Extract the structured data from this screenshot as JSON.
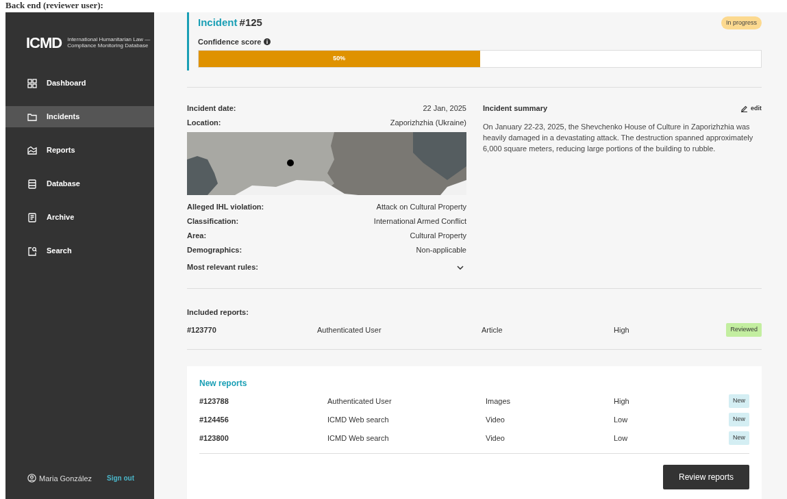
{
  "caption": "Back end (reviewer user):",
  "sidebar": {
    "logo": "ICMD",
    "logo_subtitle": "International Humanitarian Law —\nCompliance Monitoring Database",
    "items": [
      {
        "label": "Dashboard",
        "selected": false
      },
      {
        "label": "Incidents",
        "selected": true
      },
      {
        "label": "Reports",
        "selected": false
      },
      {
        "label": "Database",
        "selected": false
      },
      {
        "label": "Archive",
        "selected": false
      },
      {
        "label": "Search",
        "selected": false
      }
    ],
    "user": "Maria González",
    "sign_out": "Sign out"
  },
  "incident": {
    "label": "Incident",
    "number": "#125",
    "status": "In progress",
    "confidence_label": "Confidence score",
    "confidence": {
      "level": 0.5,
      "reading": "50%"
    }
  },
  "details_top": [
    {
      "label": "Incident date:",
      "value": "22 Jan, 2025"
    },
    {
      "label": "Location:",
      "value": "Zaporizhzhia (Ukraine)"
    }
  ],
  "details_bottom": [
    {
      "label": "Alleged IHL violation:",
      "value": "Attack on Cultural Property"
    },
    {
      "label": "Classification:",
      "value": "International Armed Conflict"
    },
    {
      "label": "Area:",
      "value": "Cultural Property"
    },
    {
      "label": "Demographics:",
      "value": "Non-applicable"
    }
  ],
  "rules": {
    "label": "Most relevant rules:",
    "expanded": false
  },
  "summary": {
    "title": "Incident summary",
    "edit": "edit",
    "text": "On January 22-23, 2025, the Shevchenko House of Culture in Zaporizhzhia was heavily damaged in a devastating attack. The destruction spanned approximately 6,000 square meters, reducing large portions of the building to rubble."
  },
  "included_reports": {
    "title": "Included reports:",
    "rows": [
      {
        "id": "#123770",
        "source": "Authenticated User",
        "type": "Article",
        "priority": "High",
        "status": "Reviewed",
        "kind": "reviewed"
      }
    ]
  },
  "new_reports": {
    "title": "New reports",
    "rows": [
      {
        "id": "#123788",
        "source": "Authenticated User",
        "type": "Images",
        "priority": "High",
        "status": "New",
        "kind": "new"
      },
      {
        "id": "#124456",
        "source": "ICMD Web search",
        "type": "Video",
        "priority": "Low",
        "status": "New",
        "kind": "new"
      },
      {
        "id": "#123800",
        "source": "ICMD Web search",
        "type": "Video",
        "priority": "Low",
        "status": "New",
        "kind": "new"
      }
    ],
    "button": "Review reports"
  }
}
